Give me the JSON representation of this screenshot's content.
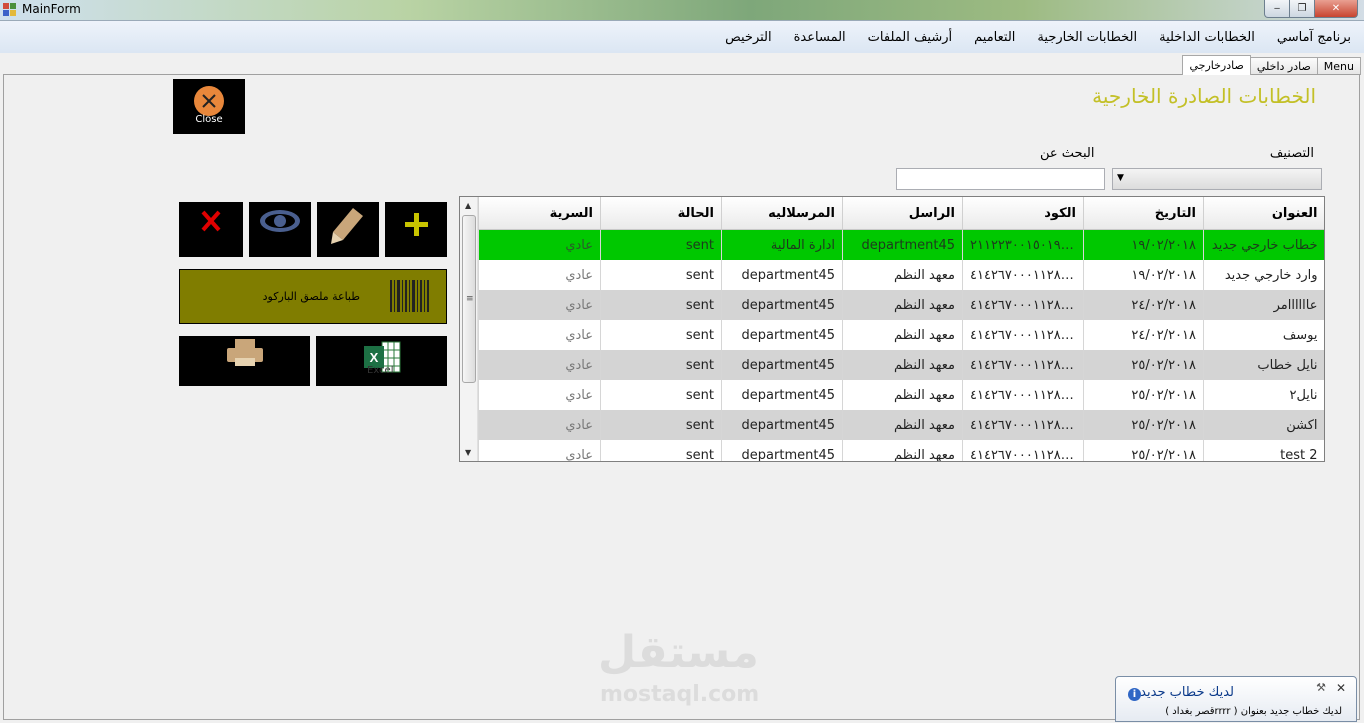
{
  "window": {
    "title": "MainForm",
    "min_glyph": "‒",
    "max_glyph": "❐",
    "close_glyph": "✕"
  },
  "menu": [
    "برنامج آماسي",
    "الخطابات الداخلية",
    "الخطابات الخارجية",
    "التعاميم",
    "أرشيف الملفات",
    "المساعدة",
    "الترخيص"
  ],
  "tabs": [
    {
      "label": "Menu",
      "active": false
    },
    {
      "label": "صادر داخلي",
      "active": false
    },
    {
      "label": "صادرخارجي",
      "active": true
    }
  ],
  "page": {
    "heading": "الخطابات الصادرة الخارجية",
    "close_label": "Close",
    "classification_label": "التصنيف",
    "search_label": "البحث عن",
    "search_value": "",
    "barcode_label": "طباعة ملصق الباركود",
    "excel_label": "Excel"
  },
  "colors": {
    "heading": "#c3c027",
    "selected_row": "#00c800",
    "barcode_button": "#807d00",
    "add_icon": "#c8c400",
    "delete_icon": "#e00000",
    "view_icon": "#4a5f8f",
    "edit_icon": "#c9a67a",
    "print_icon": "#c9a67a",
    "close_circle": "#e8873b"
  },
  "icons": {
    "add": "plus-icon",
    "edit": "pencil-icon",
    "view": "eye-icon",
    "delete": "x-icon",
    "print": "printer-icon",
    "excel": "excel-icon",
    "barcode": "barcode-icon"
  },
  "grid": {
    "columns": [
      "العنوان",
      "التاريخ",
      "الكود",
      "الراسل",
      "المرسلاليه",
      "الحالة",
      "السرية"
    ],
    "rows": [
      [
        "خطاب خارجي جديد",
        "١٩/٠٢/٢٠١٨",
        "٢١١٢٢٣٠٠١٥٠١٩٢٥...",
        "department45",
        "ادارة المالية",
        "sent",
        "عادي"
      ],
      [
        "وارد خارجي جديد",
        "١٩/٠٢/٢٠١٨",
        "٤١٤٢٦٧٠٠٠١١٢٨٤٥٤٦",
        "معهد النظم",
        "department45",
        "sent",
        "عادي"
      ],
      [
        "عاااااامر",
        "٢٤/٠٢/٢٠١٨",
        "٤١٤٢٦٧٠٠٠١١٢٨٤٥٤٦",
        "معهد النظم",
        "department45",
        "sent",
        "عادي"
      ],
      [
        "يوسف",
        "٢٤/٠٢/٢٠١٨",
        "٤١٤٢٦٧٠٠٠١١٢٨٤٥٤٦",
        "معهد النظم",
        "department45",
        "sent",
        "عادي"
      ],
      [
        "نايل خطاب",
        "٢٥/٠٢/٢٠١٨",
        "٤١٤٢٦٧٠٠٠١١٢٨٤٥٤٦",
        "معهد النظم",
        "department45",
        "sent",
        "عادي"
      ],
      [
        "نايل٢",
        "٢٥/٠٢/٢٠١٨",
        "٤١٤٢٦٧٠٠٠١١٢٨٤٥٤٦",
        "معهد النظم",
        "department45",
        "sent",
        "عادي"
      ],
      [
        "اكشن",
        "٢٥/٠٢/٢٠١٨",
        "٤١٤٢٦٧٠٠٠١١٢٨٤٥٤٦",
        "معهد النظم",
        "department45",
        "sent",
        "عادي"
      ],
      [
        "test 2",
        "٢٥/٠٢/٢٠١٨",
        "٤١٤٢٦٧٠٠٠١١٢٨٤٥٤٦",
        "معهد النظم",
        "department45",
        "sent",
        "عادي"
      ]
    ],
    "selected_index": 0
  },
  "watermark": {
    "arabic": "مستقل",
    "latin": "mostaql.com"
  },
  "notification": {
    "title": "لديك خطاب جديد",
    "body": "لديك خطاب جديد بعنوان ( rrrrقصر بغداد )",
    "info_glyph": "i",
    "pin_glyph": "⚒",
    "close_glyph": "✕"
  }
}
